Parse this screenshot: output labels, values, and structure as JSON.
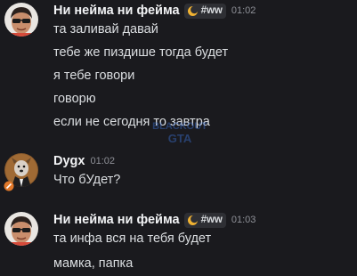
{
  "messages": [
    {
      "author": "Ни нейма ни фейма",
      "tag": "#ww",
      "time": "01:02",
      "lines": [
        "та заливай давай",
        "тебе же пиздише тогда будет",
        "я тебе говори",
        "говорю",
        "если не сегодня то завтра"
      ]
    },
    {
      "author": "Dygx",
      "time": "01:02",
      "lines": [
        "Что бУдет?"
      ]
    },
    {
      "author": "Ни нейма ни фейма",
      "tag": "#ww",
      "time": "01:03",
      "lines": [
        "та инфа вся на тебя будет",
        "мамка, папка"
      ]
    }
  ],
  "watermark": {
    "line1": "BLACKOUT",
    "line2": "GTA"
  },
  "colors": {
    "background": "#1a1a1e",
    "username": "#f2f3f5",
    "message_text": "#dbdee1",
    "timestamp": "#8e9097",
    "tag_background": "#2e2f34",
    "tag_icon": "#f0b232"
  },
  "icons": {
    "tag_icon": "moon-badge-icon",
    "avatar_1": "user-avatar-sunglasses",
    "avatar_2": "user-avatar-dog-suit",
    "avatar_3": "user-avatar-sunglasses"
  }
}
